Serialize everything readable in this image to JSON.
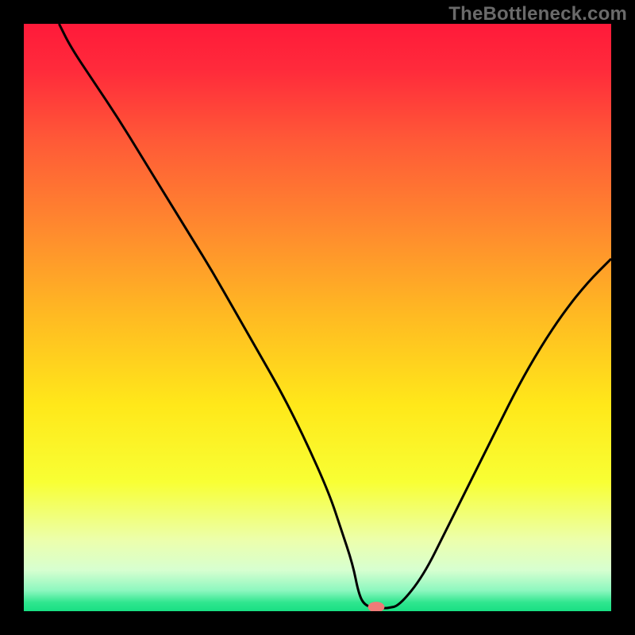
{
  "watermark": "TheBottleneck.com",
  "chart_data": {
    "type": "line",
    "title": "",
    "xlabel": "",
    "ylabel": "",
    "xlim": [
      0,
      100
    ],
    "ylim": [
      0,
      100
    ],
    "background_gradient_stops": [
      {
        "offset": 0.0,
        "color": "#ff1a3a"
      },
      {
        "offset": 0.08,
        "color": "#ff2b3b"
      },
      {
        "offset": 0.2,
        "color": "#ff5a37"
      },
      {
        "offset": 0.35,
        "color": "#ff8a2e"
      },
      {
        "offset": 0.5,
        "color": "#ffbb22"
      },
      {
        "offset": 0.65,
        "color": "#ffe81a"
      },
      {
        "offset": 0.78,
        "color": "#f8ff34"
      },
      {
        "offset": 0.88,
        "color": "#ecffad"
      },
      {
        "offset": 0.93,
        "color": "#d7ffd0"
      },
      {
        "offset": 0.965,
        "color": "#8cf7bf"
      },
      {
        "offset": 0.985,
        "color": "#30e68f"
      },
      {
        "offset": 1.0,
        "color": "#18df83"
      }
    ],
    "series": [
      {
        "name": "bottleneck-curve",
        "color": "#000000",
        "x": [
          6,
          8,
          12,
          16,
          20,
          24,
          28,
          32,
          36,
          40,
          44,
          48,
          52,
          54,
          56,
          57,
          58,
          60,
          62,
          64,
          68,
          72,
          76,
          80,
          84,
          88,
          92,
          96,
          100
        ],
        "y": [
          100,
          96,
          90,
          84,
          77.5,
          71,
          64.5,
          58,
          51,
          44,
          37,
          29,
          20,
          14,
          8,
          3,
          1,
          0.5,
          0.5,
          1,
          6,
          14,
          22,
          30,
          38,
          45,
          51,
          56,
          60
        ]
      }
    ],
    "marker": {
      "x": 60,
      "y": 0.7,
      "rx": 1.4,
      "ry": 0.9,
      "color": "#ef7b78"
    }
  }
}
